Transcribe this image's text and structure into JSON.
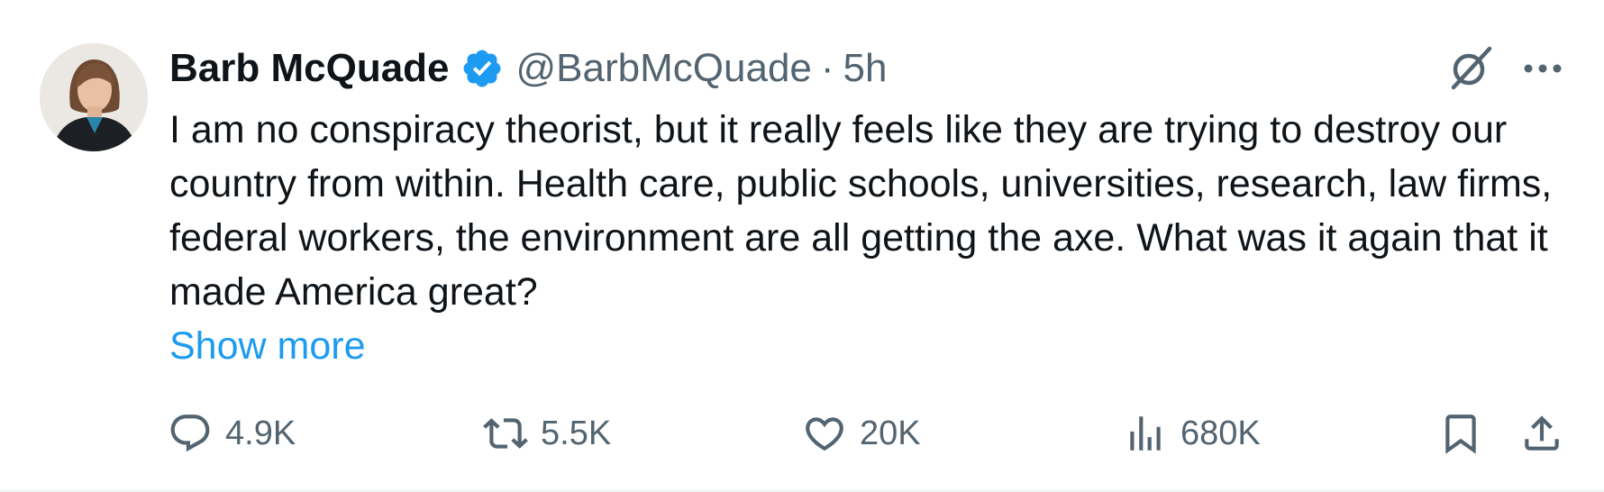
{
  "author": {
    "name": "Barb McQuade",
    "handle": "@BarbMcQuade",
    "separator": "·",
    "time": "5h",
    "verified": true,
    "avatar_icon": "profile-photo"
  },
  "post": {
    "text": "I am no conspiracy theorist, but it really feels like they are trying to destroy our country from within. Health care, public schools, universities, research, law firms, federal workers, the environment are all getting the axe. What was it again that it made America great?",
    "show_more_label": "Show more"
  },
  "header_icons": [
    "grok-icon",
    "more-icon"
  ],
  "actions": {
    "replies": "4.9K",
    "reposts": "5.5K",
    "likes": "20K",
    "views": "680K"
  },
  "colors": {
    "text": "#0f1419",
    "secondary": "#536471",
    "link": "#1d9bf0",
    "verified": "#1d9bf0"
  }
}
